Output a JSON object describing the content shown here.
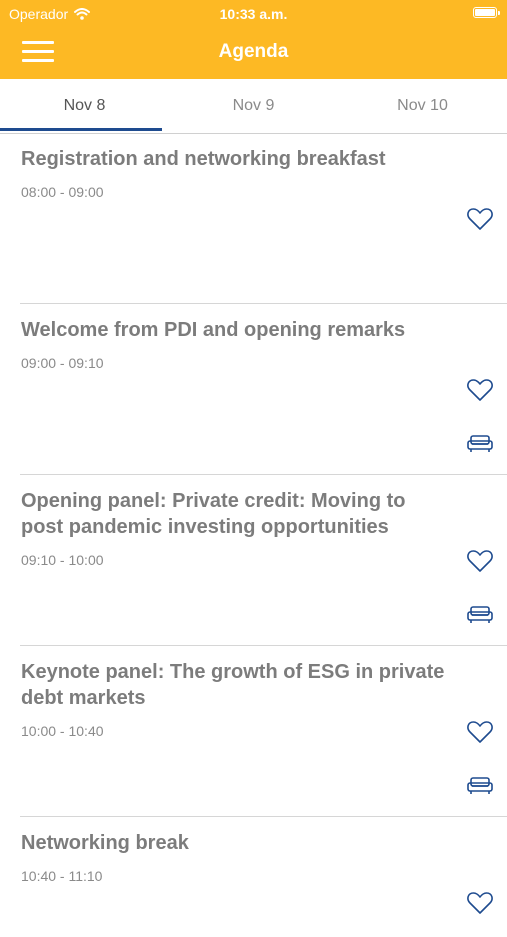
{
  "status": {
    "carrier": "Operador",
    "time": "10:33 a.m."
  },
  "header": {
    "title": "Agenda"
  },
  "tabs": [
    {
      "label": "Nov 8",
      "active": true
    },
    {
      "label": "Nov 9",
      "active": false
    },
    {
      "label": "Nov 10",
      "active": false
    }
  ],
  "sessions": [
    {
      "title": "Registration and networking breakfast",
      "time": "08:00 - 09:00",
      "icons": [
        "heart-icon"
      ]
    },
    {
      "title": "Welcome from PDI and opening remarks",
      "time": "09:00 - 09:10",
      "icons": [
        "heart-icon",
        "sofa-icon"
      ]
    },
    {
      "title": "Opening panel: Private credit: Moving to post pandemic investing opportunities",
      "time": "09:10 - 10:00",
      "icons": [
        "heart-icon",
        "sofa-icon"
      ]
    },
    {
      "title": "Keynote panel: The growth of ESG in private debt markets",
      "time": "10:00 - 10:40",
      "icons": [
        "heart-icon",
        "sofa-icon"
      ]
    },
    {
      "title": "Networking break",
      "time": "10:40 - 11:10",
      "icons": [
        "heart-icon"
      ]
    }
  ],
  "colors": {
    "header": "#FDB924",
    "accent": "#1E4B8F",
    "text_muted": "#7c7c7c"
  }
}
